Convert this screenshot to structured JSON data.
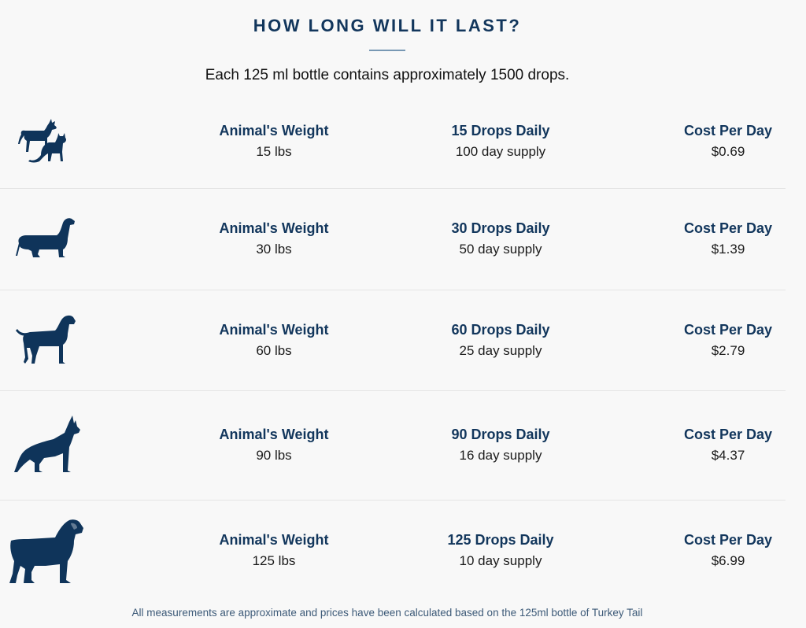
{
  "header": {
    "title": "HOW LONG WILL IT LAST?",
    "subtitle": "Each 125 ml bottle contains approximately 1500 drops."
  },
  "rows": [
    {
      "icon": "dog-and-cat-icon",
      "weight_label": "Animal's Weight",
      "weight": "15 lbs",
      "drops_label": "15 Drops Daily",
      "supply": "100 day supply",
      "cost_label": "Cost Per Day",
      "cost": "$0.69"
    },
    {
      "icon": "dachshund-icon",
      "weight_label": "Animal's Weight",
      "weight": "30 lbs",
      "drops_label": "30 Drops Daily",
      "supply": "50 day supply",
      "cost_label": "Cost Per Day",
      "cost": "$1.39"
    },
    {
      "icon": "labrador-icon",
      "weight_label": "Animal's Weight",
      "weight": "60 lbs",
      "drops_label": "60 Drops Daily",
      "supply": "25 day supply",
      "cost_label": "Cost Per Day",
      "cost": "$2.79"
    },
    {
      "icon": "german-shepherd-icon",
      "weight_label": "Animal's Weight",
      "weight": "90 lbs",
      "drops_label": "90 Drops Daily",
      "supply": "16 day supply",
      "cost_label": "Cost Per Day",
      "cost": "$4.37"
    },
    {
      "icon": "rottweiler-icon",
      "weight_label": "Animal's Weight",
      "weight": "125 lbs",
      "drops_label": "125 Drops Daily",
      "supply": "10 day supply",
      "cost_label": "Cost Per Day",
      "cost": "$6.99"
    }
  ],
  "footnote": "All measurements are approximate and prices have been calculated based on the 125ml bottle of Turkey Tail",
  "colors": {
    "accent": "#12365c",
    "background": "#f8f8f8",
    "divider": "#e4e4e4"
  }
}
